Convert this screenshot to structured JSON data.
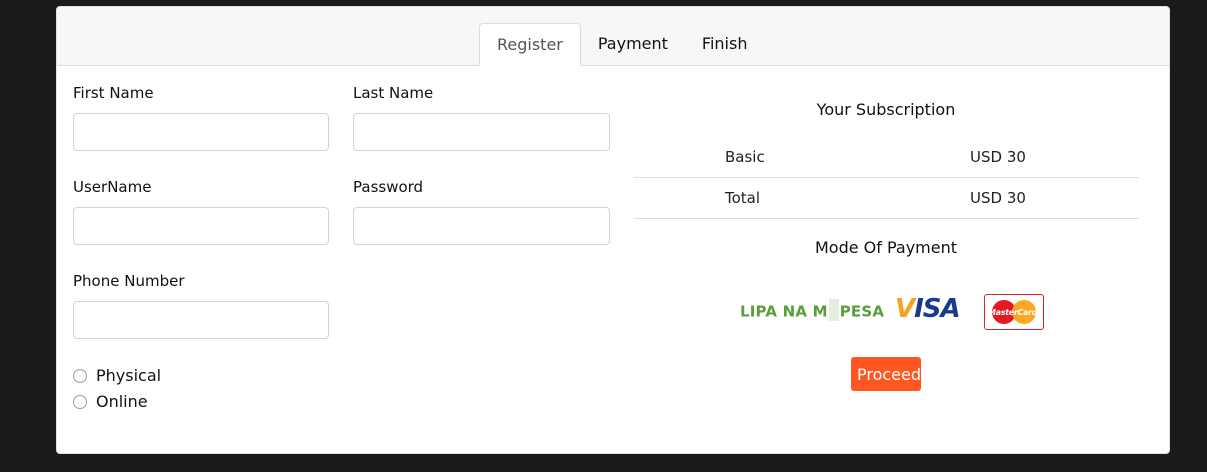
{
  "tabs": [
    {
      "label": "Register",
      "active": true
    },
    {
      "label": "Payment",
      "active": false
    },
    {
      "label": "Finish",
      "active": false
    }
  ],
  "form": {
    "first_name": {
      "label": "First Name",
      "value": "",
      "placeholder": ""
    },
    "last_name": {
      "label": "Last Name",
      "value": "",
      "placeholder": ""
    },
    "username": {
      "label": "UserName",
      "value": "",
      "placeholder": ""
    },
    "password": {
      "label": "Password",
      "value": "",
      "placeholder": ""
    },
    "phone": {
      "label": "Phone Number",
      "value": "",
      "placeholder": ""
    },
    "delivery_options": [
      {
        "label": "Physical",
        "checked": false
      },
      {
        "label": "Online",
        "checked": false
      }
    ]
  },
  "subscription": {
    "title": "Your Subscription",
    "rows": [
      {
        "name": "Basic",
        "price": "USD 30"
      },
      {
        "name": "Total",
        "price": "USD 30"
      }
    ]
  },
  "payment": {
    "title": "Mode Of Payment",
    "methods": [
      {
        "name": "mpesa",
        "text": "LIPA NA M-PESA",
        "color": "#5a9e3a"
      },
      {
        "name": "visa",
        "text": "VISA",
        "color": "#1a3a8f"
      },
      {
        "name": "mastercard",
        "text": "MasterCard",
        "color": "#e21b22"
      }
    ],
    "proceed_label": "Proceed",
    "proceed_color": "#ff5722"
  }
}
